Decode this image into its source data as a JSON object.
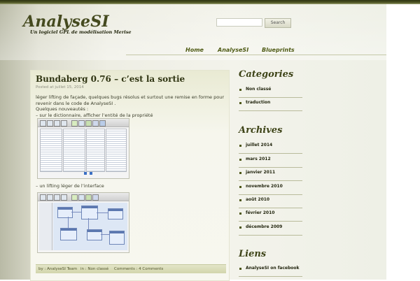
{
  "site": {
    "title": "AnalyseSI",
    "tagline": "Un logiciel GPL de modélisation Merise"
  },
  "search": {
    "placeholder": "",
    "button_label": "Search"
  },
  "nav": {
    "items": [
      "Home",
      "AnalyseSI",
      "Blueprints"
    ]
  },
  "post": {
    "title": "Bundaberg 0.76 – c’est la sortie",
    "date": "Posted at juillet 15, 2014",
    "paragraph_1": "léger lifting de façade, quelques bugs résolus et surtout une remise en forme pour revenir dans le code de AnalyseSI .",
    "paragraph_2": "Quelques nouveautés :",
    "paragraph_3": "– sur le dictionnaire, afficher l’entité de la propriété",
    "paragraph_4": "– un lifting léger de l’interface",
    "meta": {
      "author": "by : AnalyseSI Team",
      "category": "in : Non classé",
      "comments": "Comments : 4 Comments"
    }
  },
  "sidebar": {
    "categories": {
      "heading": "Categories",
      "items": [
        "Non classé",
        "traduction"
      ]
    },
    "archives": {
      "heading": "Archives",
      "items": [
        "juillet 2014",
        "mars 2012",
        "janvier 2011",
        "novembre 2010",
        "août 2010",
        "février 2010",
        "décembre 2009"
      ]
    },
    "links": {
      "heading": "Liens",
      "items": [
        "AnalyseSI on facebook"
      ]
    }
  },
  "colors": {
    "accent": "#4e5a14",
    "heading": "#3e4418",
    "background": "#f3f3eb",
    "meta_bar": "#d9dbb8"
  }
}
